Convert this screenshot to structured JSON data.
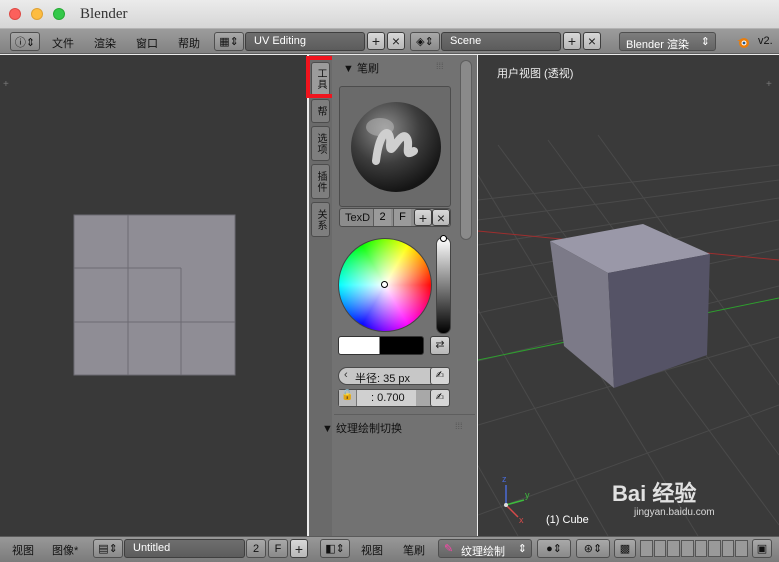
{
  "window": {
    "title": "Blender"
  },
  "topbar": {
    "info_icon": "info-icon",
    "menus": [
      "文件",
      "渲染",
      "窗口",
      "帮助"
    ],
    "layout": {
      "name": "UV Editing",
      "add": "+",
      "remove": "×"
    },
    "scene": {
      "name": "Scene",
      "add": "+",
      "remove": "×"
    },
    "engine": "Blender 渲染",
    "version": "v2."
  },
  "tool_tabs": [
    "工具",
    "帮",
    "选项",
    "插件",
    "关系"
  ],
  "brush_panel": {
    "title": "▼ 笔刷",
    "texture_name": "TexD",
    "users": "2",
    "fake_user": "F",
    "add": "+",
    "remove": "×",
    "radius": "半径: 35 px",
    "strength": ": 0.700"
  },
  "texpaint_panel": {
    "title": "▼ 纹理绘制切换"
  },
  "viewport": {
    "label": "用户视图 (透视)",
    "object_label": "(1) Cube"
  },
  "uv_bottombar": {
    "menus": [
      "视图",
      "图像*"
    ],
    "image_name": "Untitled",
    "users": "2",
    "fake_user": "F",
    "add": "+"
  },
  "view3d_bottombar": {
    "menus": [
      "视图",
      "笔刷"
    ],
    "mode": "纹理绘制"
  },
  "watermark": {
    "text": "Bai 经验",
    "url": "jingyan.baidu.com"
  },
  "colors": {
    "uv_bg": "#393939",
    "panel_bg": "#727272",
    "view3d_bg": "#3a3a3a",
    "accent_red": "#f0141e"
  }
}
